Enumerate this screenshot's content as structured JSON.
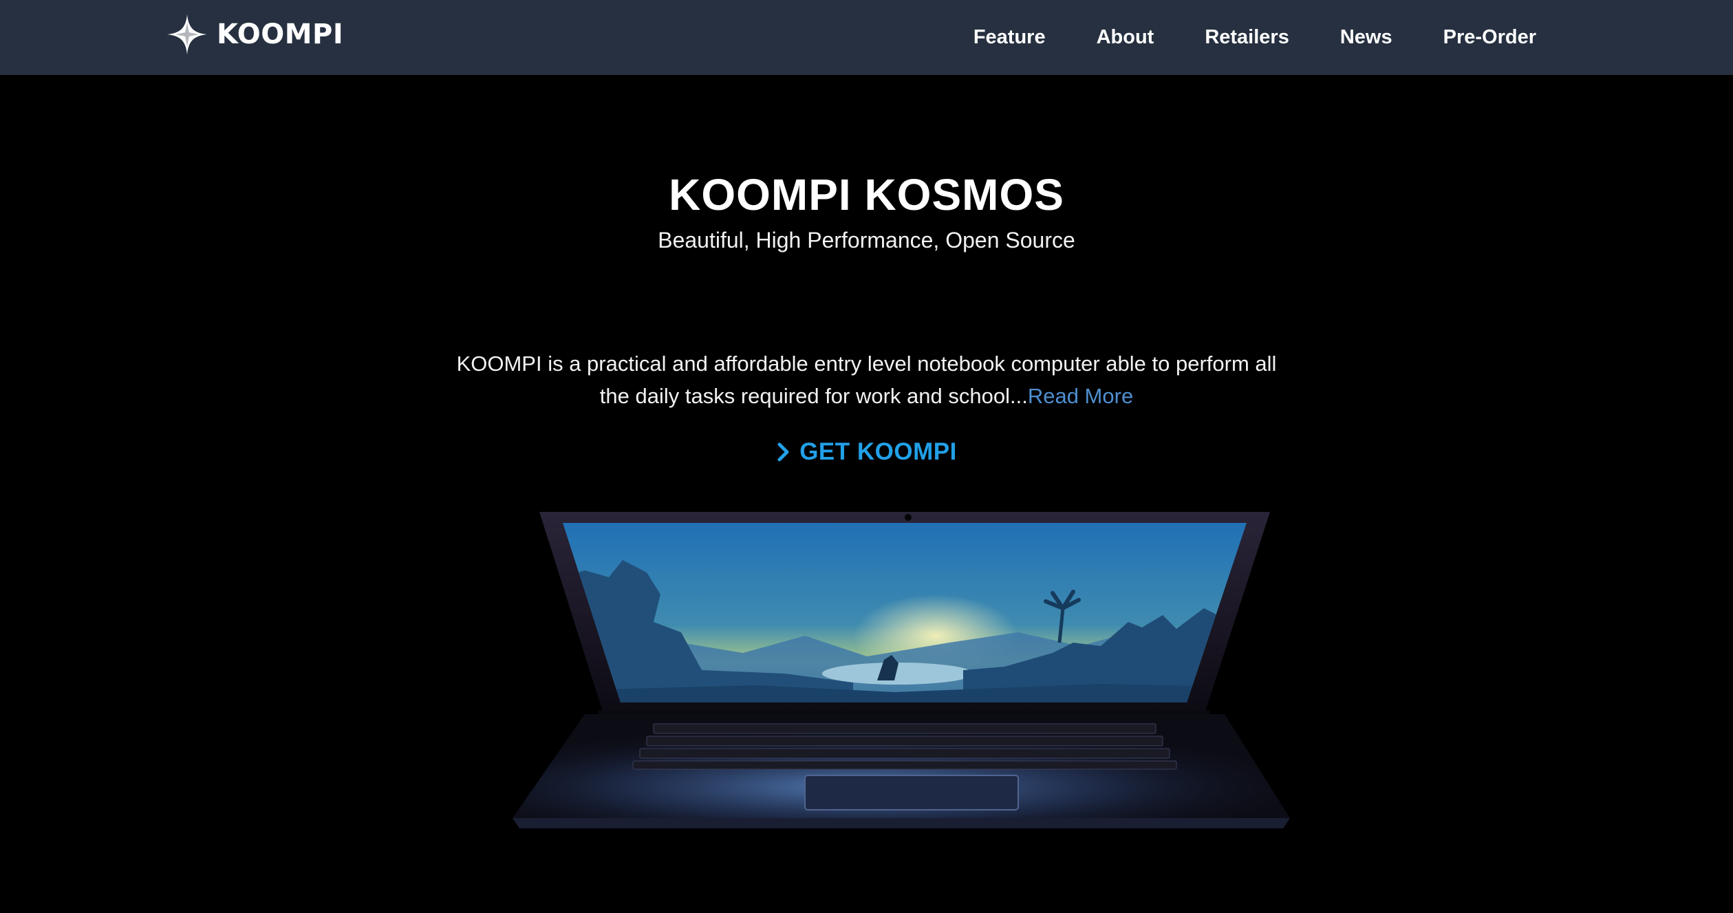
{
  "brand": {
    "name": "KOOMPI",
    "icon": "four-point-star-icon"
  },
  "nav": {
    "items": [
      {
        "label": "Feature"
      },
      {
        "label": "About"
      },
      {
        "label": "Retailers"
      },
      {
        "label": "News"
      },
      {
        "label": "Pre-Order"
      }
    ]
  },
  "hero": {
    "title": "KOOMPI KOSMOS",
    "subtitle": "Beautiful, High Performance, Open Source",
    "description": "KOOMPI is a practical and affordable entry level notebook computer able to perform all the daily tasks required for work and school...",
    "read_more": "Read More",
    "cta_label": "GET KOOMPI",
    "cta_icon": "chevron-right-icon"
  },
  "colors": {
    "navbar_bg": "#263040",
    "page_bg": "#000000",
    "link": "#4f8fd0",
    "cta": "#22a0e8"
  }
}
